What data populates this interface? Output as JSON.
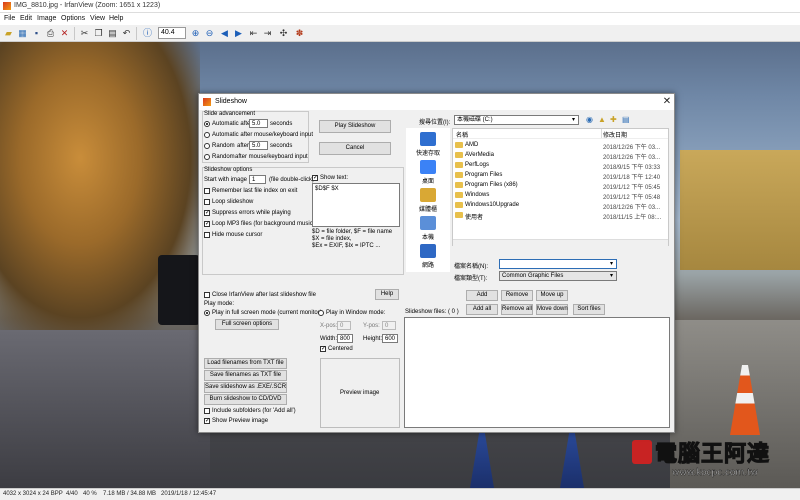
{
  "window": {
    "title": "IMG_8810.jpg - IrfanView (Zoom: 1651 x 1223)"
  },
  "menu": [
    "File",
    "Edit",
    "Image",
    "Options",
    "View",
    "Help"
  ],
  "toolbar": {
    "zoom_value": "40.4"
  },
  "status": {
    "dims": "4032 x 3024 x 24 BPP",
    "index": "4/40",
    "zoom": "40 %",
    "size": "7.18 MB / 34.88 MB",
    "datetime": "2019/1/18 / 12:45:47"
  },
  "watermark": {
    "text": "電腦王阿達",
    "url": "www.kocpc.com.tw"
  },
  "dialog": {
    "title": "Slideshow",
    "advancement": {
      "heading": "Slide advancement",
      "auto_after": "Automatic after",
      "seconds": "seconds",
      "seconds2": "seconds",
      "auto_value": "5.0",
      "auto_mouse": "Automatic after mouse/keyboard input",
      "random_after": "Random",
      "random_after2": "after",
      "random_value": "5.0",
      "random_mouse": "Random",
      "random_mouse2": "after mouse/keyboard input"
    },
    "buttons": {
      "play": "Play Slideshow",
      "cancel": "Cancel",
      "help": "Help",
      "full_screen_options": "Full screen options",
      "load_txt": "Load filenames from TXT file",
      "save_txt": "Save filenames as TXT file",
      "save_exe": "Save slideshow as .EXE/.SCR",
      "burn": "Burn slideshow to CD/DVD",
      "preview": "Preview image",
      "add": "Add",
      "remove": "Remove",
      "move_up": "Move up",
      "add_all": "Add all",
      "remove_all": "Remove all",
      "move_down": "Move down",
      "sort_files": "Sort files"
    },
    "options": {
      "heading": "Slideshow options",
      "start_with": "Start with image nr.:",
      "start_value": "1",
      "start_hint": "(file double-click)",
      "remember": "Remember last file index on exit",
      "loop": "Loop slideshow",
      "suppress": "Suppress errors while playing",
      "loop_mp3": "Loop MP3 files (for background music)",
      "hide_cursor": "Hide mouse cursor",
      "show_text": "Show text:",
      "text_value": "$D$F $X",
      "hint1": "$D = file folder, $F = file name",
      "hint2": "$X = file index,",
      "hint3": "$Ex = EXIF, $Ix = IPTC ..."
    },
    "close_after": "Close IrfanView after last slideshow file",
    "play_mode": {
      "heading": "Play mode:",
      "full_screen": "Play in full screen mode (current monitor)",
      "window_mode": "Play in Window mode:",
      "xpos_label": "X-pos:",
      "xpos": "0",
      "ypos_label": "Y-pos:",
      "ypos": "0",
      "width_label": "Width:",
      "width": "800",
      "height_label": "Height:",
      "height": "600",
      "centered": "Centered"
    },
    "include_sub": "Include subfolders (for 'Add all')",
    "show_preview": "Show Preview image",
    "browser": {
      "lookin_label": "搜尋位置(I):",
      "lookin_value": "本機磁碟 (C:)",
      "col_name": "名稱",
      "col_date": "修改日期",
      "places": [
        "快速存取",
        "桌面",
        "媒體櫃",
        "本機",
        "網路"
      ],
      "files": [
        {
          "name": "AMD",
          "date": "2018/12/26 下午 03..."
        },
        {
          "name": "AVerMedia",
          "date": "2018/12/26 下午 03..."
        },
        {
          "name": "PerfLogs",
          "date": "2018/9/15 下午 03:33"
        },
        {
          "name": "Program Files",
          "date": "2019/1/18 下午 12:40"
        },
        {
          "name": "Program Files (x86)",
          "date": "2019/1/12 下午 05:45"
        },
        {
          "name": "Windows",
          "date": "2019/1/12 下午 05:48"
        },
        {
          "name": "Windows10Upgrade",
          "date": "2018/12/26 下午 03..."
        },
        {
          "name": "使用者",
          "date": "2018/11/15 上午 08:..."
        }
      ],
      "filename_label": "檔案名稱(N):",
      "filetype_label": "檔案類型(T):",
      "filetype_value": "Common Graphic Files",
      "slideshow_files": "Slideshow files:  ( 0 )"
    }
  }
}
